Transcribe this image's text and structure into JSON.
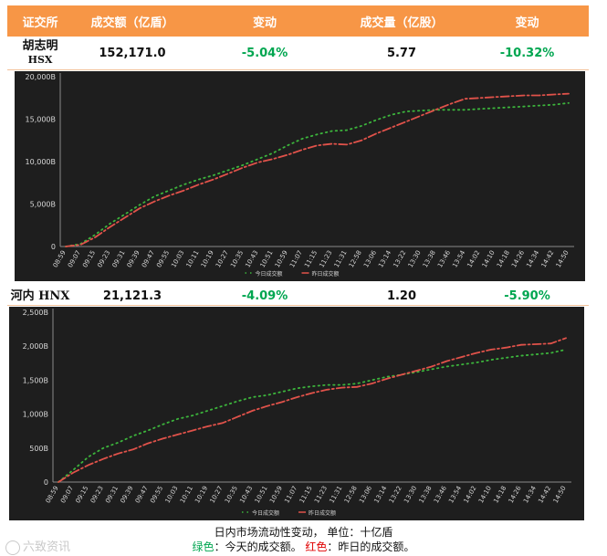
{
  "header": {
    "col1": "证交所",
    "col2": "成交额（亿盾）",
    "col3": "变动",
    "col4": "成交量（亿股）",
    "col5": "变动"
  },
  "hsx": {
    "name_line1": "胡志明",
    "name_line2": "HSX",
    "value": "152,171.0",
    "value_change": "-5.04%",
    "volume": "5.77",
    "volume_change": "-10.32%"
  },
  "hnx": {
    "name": "河内 HNX",
    "value": "21,121.3",
    "value_change": "-4.09%",
    "volume": "1.20",
    "volume_change": "-5.90%"
  },
  "footer": {
    "line1": "日内市场流动性变动，  单位：十亿盾",
    "green_label": "绿色",
    "green_text": "：今天的成交额。",
    "red_label": "红色",
    "red_text": "：昨日的成交额。"
  },
  "watermark": "六致资讯",
  "colors": {
    "header_bg": "#f79646",
    "chart_bg": "#1e1e1e",
    "today": "#3cb43c",
    "yesterday": "#e0524a",
    "change_text": "#00a650"
  },
  "chart_data": [
    {
      "type": "line",
      "ylim": [
        0,
        20000
      ],
      "yticks": [
        0,
        5000,
        10000,
        15000,
        20000
      ],
      "ytick_labels": [
        "0",
        "5,000B",
        "10,000B",
        "15,000B",
        "20,000B"
      ],
      "x": [
        "08:59",
        "09:07",
        "09:15",
        "09:23",
        "09:31",
        "09:39",
        "09:47",
        "09:55",
        "10:03",
        "10:11",
        "10:19",
        "10:27",
        "10:35",
        "10:43",
        "10:51",
        "10:59",
        "11:07",
        "11:15",
        "11:23",
        "11:31",
        "12:58",
        "13:06",
        "13:14",
        "13:22",
        "13:30",
        "13:38",
        "13:46",
        "13:54",
        "14:02",
        "14:10",
        "14:18",
        "14:26",
        "14:34",
        "14:42",
        "14:50"
      ],
      "xtick_labels": [
        "08:59",
        "09:07",
        "09:15",
        "09:23",
        "09:31",
        "09:39",
        "09:47",
        "09:55",
        "10:03",
        "10:11",
        "10:19",
        "10:27",
        "10:35",
        "10:43",
        "10:51",
        "10:59",
        "11:07",
        "11:15",
        "11:23",
        "11:31",
        "12:58",
        "13:06",
        "13:14",
        "13:22",
        "13:30",
        "13:38",
        "13:46",
        "13:54",
        "14:02",
        "14:10",
        "14:18",
        "14:26",
        "14:34",
        "14:42",
        "14:50"
      ],
      "legend": [
        "今日成交额",
        "昨日成交额"
      ],
      "legend_position": "bottom",
      "series": [
        {
          "name": "今日成交额",
          "style": "dotted",
          "values": [
            0,
            300,
            1400,
            2700,
            3800,
            4900,
            5900,
            6600,
            7300,
            7900,
            8400,
            9000,
            9600,
            10300,
            11000,
            11900,
            12700,
            13200,
            13600,
            13700,
            14200,
            14900,
            15500,
            15900,
            16000,
            16100,
            16100,
            16100,
            16200,
            16300,
            16400,
            16500,
            16600,
            16700,
            16900
          ]
        },
        {
          "name": "昨日成交额",
          "style": "dash-dot",
          "values": [
            0,
            200,
            1100,
            2300,
            3400,
            4500,
            5300,
            6000,
            6600,
            7300,
            7900,
            8600,
            9300,
            9900,
            10300,
            10800,
            11400,
            11900,
            12100,
            12000,
            12500,
            13300,
            14000,
            14700,
            15400,
            16100,
            16800,
            17400,
            17500,
            17600,
            17700,
            17800,
            17800,
            17900,
            18000
          ]
        }
      ]
    },
    {
      "type": "line",
      "ylim": [
        0,
        2500
      ],
      "yticks": [
        0,
        500,
        1000,
        1500,
        2000,
        2500
      ],
      "ytick_labels": [
        "0",
        "500B",
        "1,000B",
        "1,500B",
        "2,000B",
        "2,500B"
      ],
      "x": [
        "08:59",
        "09:07",
        "09:15",
        "09:23",
        "09:31",
        "09:39",
        "09:47",
        "09:55",
        "10:03",
        "10:11",
        "10:19",
        "10:27",
        "10:35",
        "10:43",
        "10:51",
        "10:59",
        "11:07",
        "11:15",
        "11:23",
        "11:31",
        "12:58",
        "13:06",
        "13:14",
        "13:22",
        "13:30",
        "13:38",
        "13:46",
        "13:54",
        "14:02",
        "14:10",
        "14:18",
        "14:26",
        "14:34",
        "14:42",
        "14:50"
      ],
      "xtick_labels": [
        "08:59",
        "09:07",
        "09:15",
        "09:23",
        "09:31",
        "09:39",
        "09:47",
        "09:55",
        "10:03",
        "10:11",
        "10:19",
        "10:27",
        "10:35",
        "10:43",
        "10:51",
        "10:59",
        "11:07",
        "11:15",
        "11:23",
        "11:31",
        "12:58",
        "13:06",
        "13:14",
        "13:22",
        "13:30",
        "13:38",
        "13:46",
        "13:54",
        "14:02",
        "14:10",
        "14:18",
        "14:26",
        "14:34",
        "14:42",
        "14:50"
      ],
      "legend": [
        "今日成交额",
        "昨日成交额"
      ],
      "legend_position": "bottom",
      "series": [
        {
          "name": "今日成交额",
          "style": "dotted",
          "values": [
            0,
            180,
            370,
            500,
            580,
            680,
            760,
            850,
            930,
            980,
            1050,
            1120,
            1190,
            1250,
            1280,
            1330,
            1380,
            1410,
            1430,
            1430,
            1450,
            1500,
            1550,
            1580,
            1620,
            1660,
            1700,
            1730,
            1760,
            1800,
            1830,
            1860,
            1880,
            1900,
            1950
          ]
        },
        {
          "name": "昨日成交额",
          "style": "dash-dot",
          "values": [
            0,
            140,
            250,
            340,
            420,
            480,
            570,
            640,
            700,
            760,
            820,
            870,
            960,
            1050,
            1120,
            1180,
            1250,
            1310,
            1360,
            1390,
            1400,
            1450,
            1520,
            1580,
            1640,
            1700,
            1780,
            1840,
            1900,
            1950,
            1980,
            2020,
            2030,
            2040,
            2120
          ]
        }
      ]
    }
  ]
}
